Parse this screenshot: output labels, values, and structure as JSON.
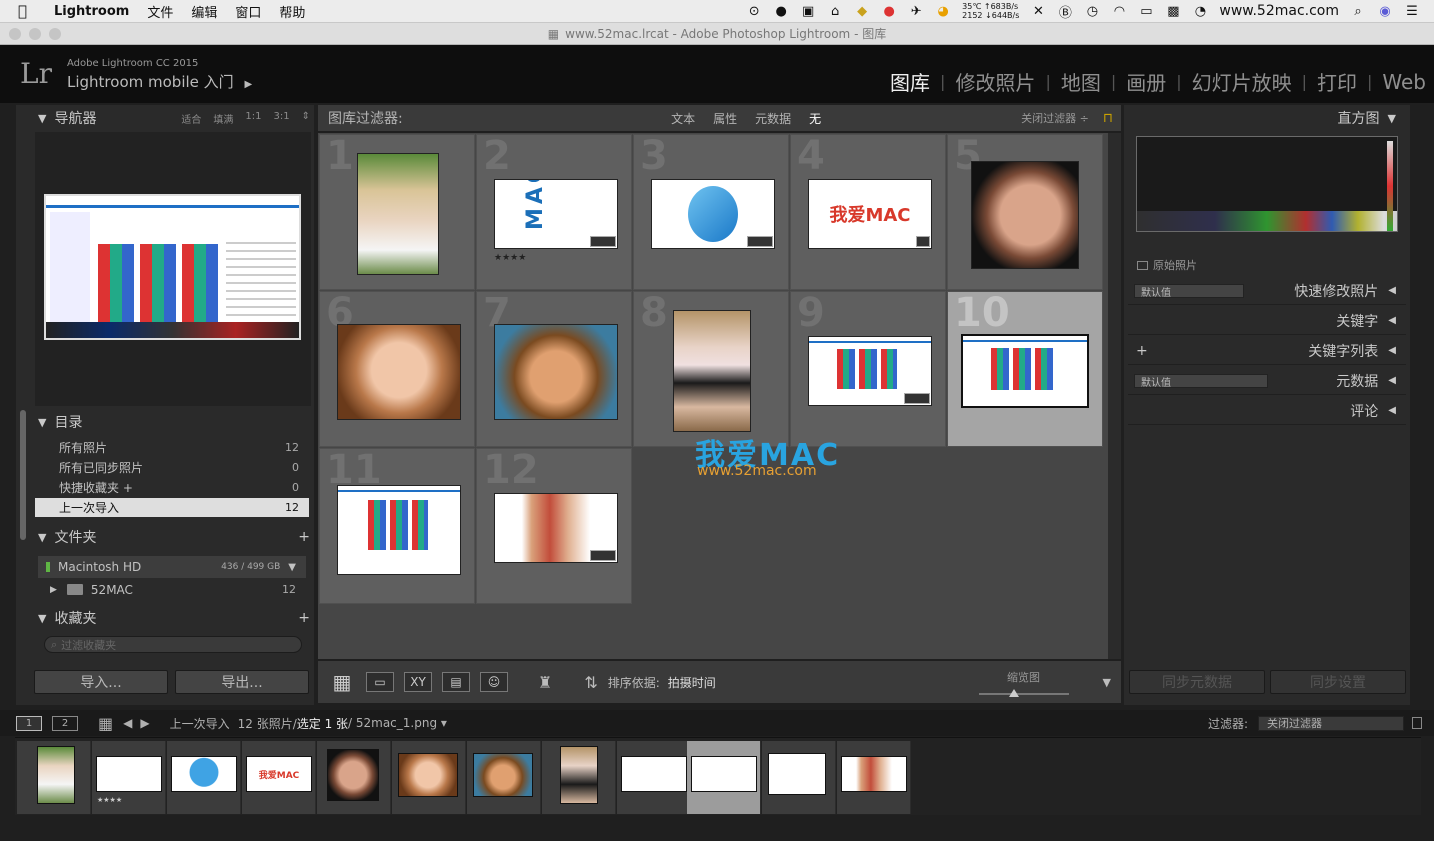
{
  "menubar": {
    "apple": "",
    "app_name": "Lightroom",
    "items": [
      "文件",
      "编辑",
      "窗口",
      "帮助"
    ],
    "temp": "35℃",
    "temp_sub": "2152",
    "net_up": "↑683B/s",
    "net_down": "↓644B/s",
    "site": "www.52mac.com"
  },
  "titlebar": {
    "icon": "▦",
    "text": "www.52mac.lrcat - Adobe Photoshop Lightroom - 图库"
  },
  "identity": {
    "logo": "Lr",
    "line1": "Adobe Lightroom CC 2015",
    "line2": "Lightroom mobile 入门",
    "arrow": "▶"
  },
  "modules": [
    "图库",
    "修改照片",
    "地图",
    "画册",
    "幻灯片放映",
    "打印",
    "Web"
  ],
  "module_sep": "|",
  "navigator": {
    "title": "导航器",
    "zoom": [
      "适合",
      "填满",
      "1:1",
      "3:1"
    ],
    "zoom_arrow": "⇕"
  },
  "catalog": {
    "title": "目录",
    "items": [
      {
        "label": "所有照片",
        "count": "12"
      },
      {
        "label": "所有已同步照片",
        "count": "0"
      },
      {
        "label": "快捷收藏夹 +",
        "count": "0"
      },
      {
        "label": "上一次导入",
        "count": "12"
      }
    ]
  },
  "folders": {
    "title": "文件夹",
    "drive": "Macintosh HD",
    "drive_usage": "436 / 499 GB",
    "folder": "52MAC",
    "folder_count": "12",
    "plus": "+"
  },
  "collections": {
    "title": "收藏夹",
    "search_placeholder": "过滤收藏夹",
    "plus": "+"
  },
  "left_buttons": {
    "import": "导入...",
    "export": "导出..."
  },
  "filter_bar": {
    "label": "图库过滤器:",
    "options": [
      "文本",
      "属性",
      "元数据",
      "无"
    ],
    "preset": "关闭过滤器 ÷"
  },
  "grid": {
    "indexes": [
      "1",
      "2",
      "3",
      "4",
      "5",
      "6",
      "7",
      "8",
      "9",
      "10",
      "11",
      "12"
    ],
    "stars_2": "★★★★",
    "watermark_cn": "我爱MAC",
    "watermark_url": "www.52mac.com",
    "logo_text_2": "MAC.C",
    "logo_text_4": "我爱MAC",
    "badge_glyph": "◪"
  },
  "toolbar": {
    "sort_label": "排序依据:",
    "sort_value": "拍摄时间",
    "thumb_label": "缩览图",
    "grid_icon": "▦",
    "loupe_icon": "▭",
    "compare_icon": "XY",
    "survey_icon": "▤",
    "people_icon": "☺",
    "spray_icon": "♜",
    "sort_icon": "⇅"
  },
  "right_panel": {
    "histogram": "直方图",
    "original": "原始照片",
    "quick_develop": "快速修改照片",
    "quick_preset": "默认值",
    "keywording": "关键字",
    "keyword_list": "关键字列表",
    "metadata": "元数据",
    "metadata_preset": "默认值",
    "comments": "评论",
    "sync_meta": "同步元数据",
    "sync_settings": "同步设置",
    "caret": "◀",
    "caret_down": "▼",
    "plus": "+"
  },
  "filmstrip_nav": {
    "page1": "1",
    "page2": "2",
    "source": "上一次导入",
    "count_info": "12 张照片/",
    "selected": "选定 1 张",
    "filename": "/ 52mac_1.png ▾",
    "filter_label": "过滤器:",
    "filter_value": "关闭过滤器"
  },
  "colors": {
    "accent_blue": "#29a4e0",
    "accent_orange": "#e6a033",
    "logo_red": "#d8392b"
  }
}
